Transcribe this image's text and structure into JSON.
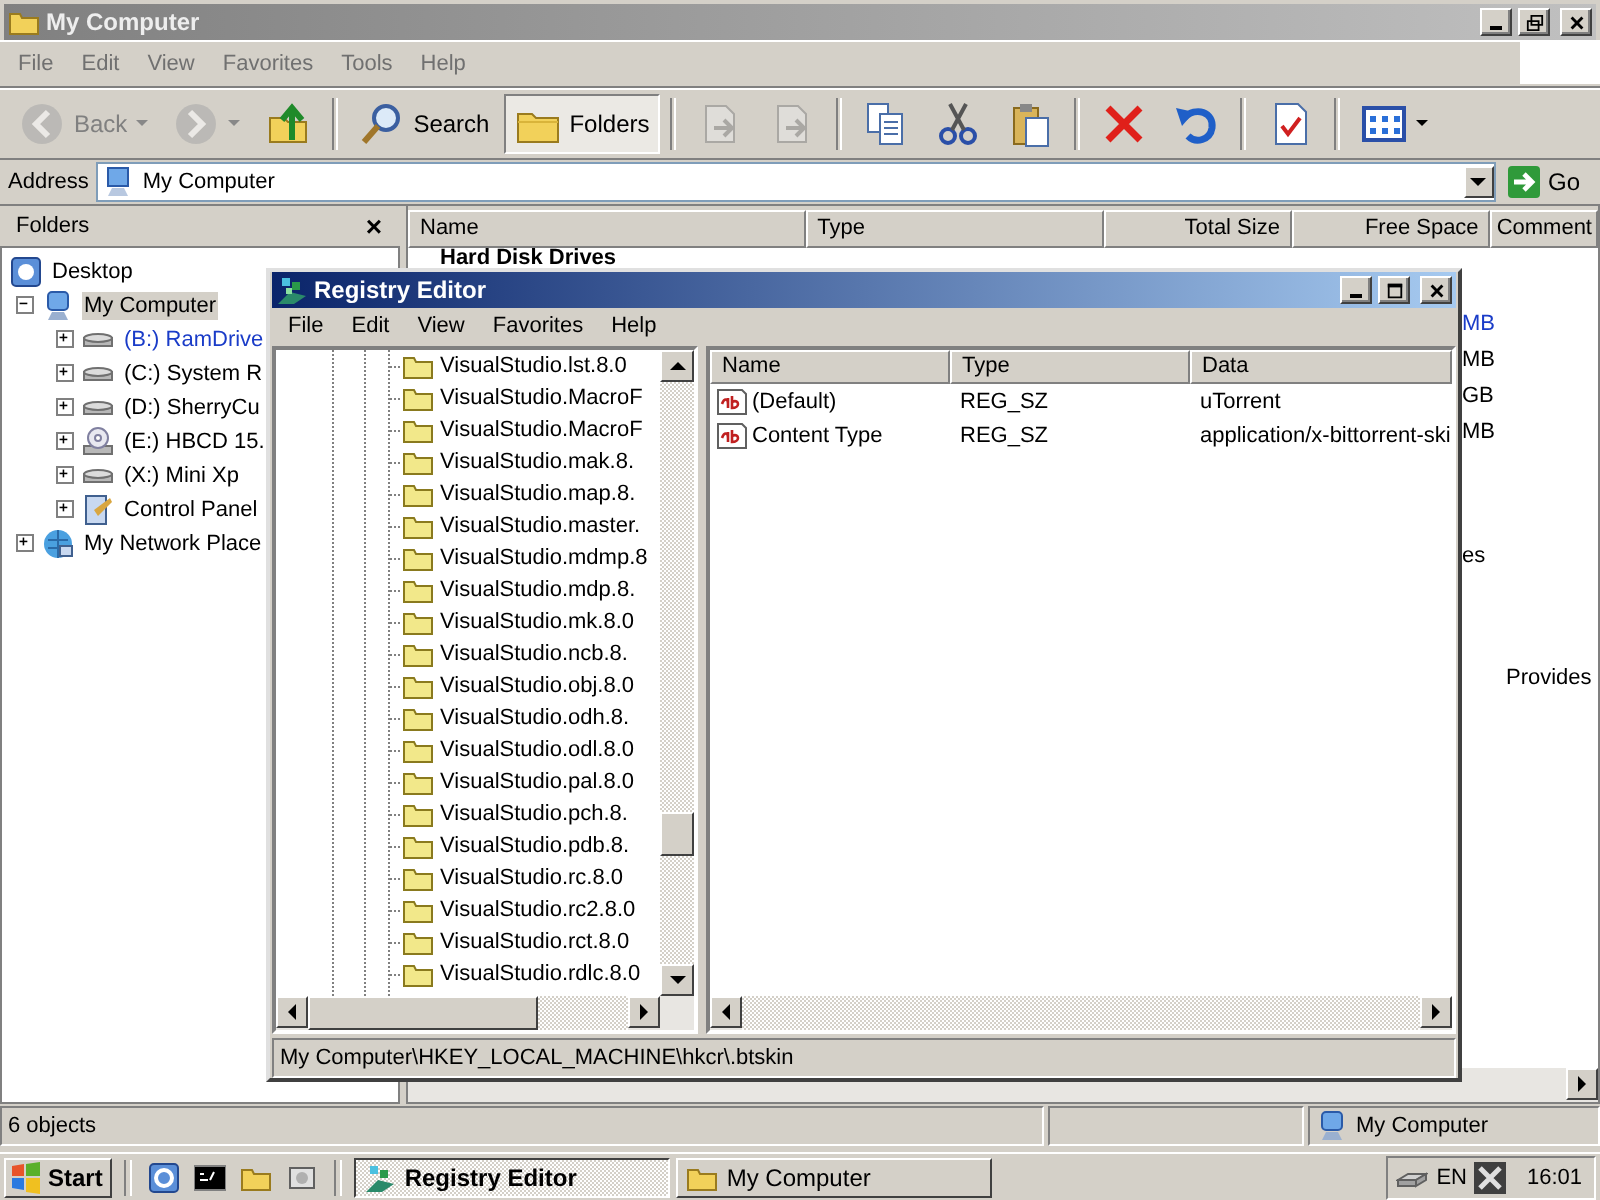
{
  "explorer": {
    "title": "My Computer",
    "active": false,
    "menu": [
      "File",
      "Edit",
      "View",
      "Favorites",
      "Tools",
      "Help"
    ],
    "toolbar": [
      {
        "kind": "back",
        "label": "Back",
        "disabled": true,
        "selected": false
      },
      {
        "kind": "forward",
        "disabled": true,
        "selected": false
      },
      {
        "kind": "up",
        "disabled": false,
        "selected": false
      },
      {
        "kind": "separator"
      },
      {
        "kind": "search",
        "label": "Search",
        "disabled": false,
        "selected": false
      },
      {
        "kind": "folders",
        "label": "Folders",
        "disabled": false,
        "selected": true
      },
      {
        "kind": "separator"
      },
      {
        "kind": "move",
        "disabled": true,
        "selected": false
      },
      {
        "kind": "copyto",
        "disabled": true,
        "selected": false
      },
      {
        "kind": "separator"
      },
      {
        "kind": "copy",
        "disabled": false,
        "selected": false
      },
      {
        "kind": "cut",
        "disabled": false,
        "selected": false
      },
      {
        "kind": "paste",
        "disabled": false,
        "selected": false
      },
      {
        "kind": "separator"
      },
      {
        "kind": "delete",
        "disabled": false,
        "selected": false
      },
      {
        "kind": "undo",
        "disabled": false,
        "selected": false
      },
      {
        "kind": "separator"
      },
      {
        "kind": "properties",
        "disabled": false,
        "selected": false
      },
      {
        "kind": "separator"
      },
      {
        "kind": "views",
        "disabled": false,
        "selected": false
      }
    ],
    "address": {
      "label": "Address",
      "value": "My Computer",
      "go": "Go"
    },
    "folders": {
      "title": "Folders",
      "close": "×",
      "tree": [
        {
          "label": "Desktop",
          "kind": "desktop",
          "selected": false,
          "hot": false,
          "children": [
            {
              "label": "My Computer",
              "kind": "computer",
              "expanded": true,
              "selected": true,
              "hot": false,
              "children": [
                {
                  "label": "(B:) RamDrive",
                  "kind": "drive",
                  "expanded": false,
                  "selected": false,
                  "hot": true
                },
                {
                  "label": "(C:) System R",
                  "kind": "drive",
                  "expanded": false,
                  "selected": false,
                  "hot": false
                },
                {
                  "label": "(D:) SherryCu",
                  "kind": "drive",
                  "expanded": false,
                  "selected": false,
                  "hot": false
                },
                {
                  "label": "(E:) HBCD 15.",
                  "kind": "cdrom",
                  "expanded": false,
                  "selected": false,
                  "hot": false
                },
                {
                  "label": "(X:) Mini Xp",
                  "kind": "drive",
                  "expanded": false,
                  "selected": false,
                  "hot": false
                },
                {
                  "label": "Control Panel",
                  "kind": "control-panel",
                  "expanded": false,
                  "selected": false,
                  "hot": false
                }
              ]
            },
            {
              "label": "My Network Place",
              "kind": "network",
              "expanded": false,
              "selected": false,
              "hot": false
            }
          ]
        }
      ]
    },
    "list": {
      "columns": [
        "Name",
        "Type",
        "Total Size",
        "Free Space",
        "Comment"
      ],
      "group": "Hard Disk Drives",
      "visible_fragments": [
        {
          "text": "MB",
          "hot": true
        },
        {
          "text": "MB",
          "hot": false
        },
        {
          "text": "GB",
          "hot": false
        },
        {
          "text": "MB",
          "hot": false
        },
        {
          "text": "es",
          "hot": false
        },
        {
          "text": "Provides",
          "hot": false
        }
      ]
    },
    "status": {
      "text": "6 objects",
      "zone": "My Computer"
    }
  },
  "regedit": {
    "title": "Registry Editor",
    "active": true,
    "menu": [
      "File",
      "Edit",
      "View",
      "Favorites",
      "Help"
    ],
    "keys": [
      "VisualStudio.lst.8.0",
      "VisualStudio.MacroF",
      "VisualStudio.MacroF",
      "VisualStudio.mak.8.",
      "VisualStudio.map.8.",
      "VisualStudio.master.",
      "VisualStudio.mdmp.8",
      "VisualStudio.mdp.8.",
      "VisualStudio.mk.8.0",
      "VisualStudio.ncb.8.",
      "VisualStudio.obj.8.0",
      "VisualStudio.odh.8.",
      "VisualStudio.odl.8.0",
      "VisualStudio.pal.8.0",
      "VisualStudio.pch.8.",
      "VisualStudio.pdb.8.",
      "VisualStudio.rc.8.0",
      "VisualStudio.rc2.8.0",
      "VisualStudio.rct.8.0",
      "VisualStudio.rdlc.8.0"
    ],
    "columns": [
      "Name",
      "Type",
      "Data"
    ],
    "values": [
      {
        "name": "(Default)",
        "type": "REG_SZ",
        "data": "uTorrent"
      },
      {
        "name": "Content Type",
        "type": "REG_SZ",
        "data": "application/x-bittorrent-ski"
      }
    ],
    "status": "My Computer\\HKEY_LOCAL_MACHINE\\hkcr\\.btskin"
  },
  "taskbar": {
    "start": "Start",
    "quick_launch": [
      {
        "kind": "browser"
      },
      {
        "kind": "console"
      },
      {
        "kind": "folder"
      },
      {
        "kind": "drive"
      }
    ],
    "tasks": [
      {
        "label": "Registry Editor",
        "kind": "regedit",
        "selected": true
      },
      {
        "label": "My Computer",
        "kind": "folder",
        "selected": false
      }
    ],
    "language": "EN",
    "clock": "16:01"
  }
}
